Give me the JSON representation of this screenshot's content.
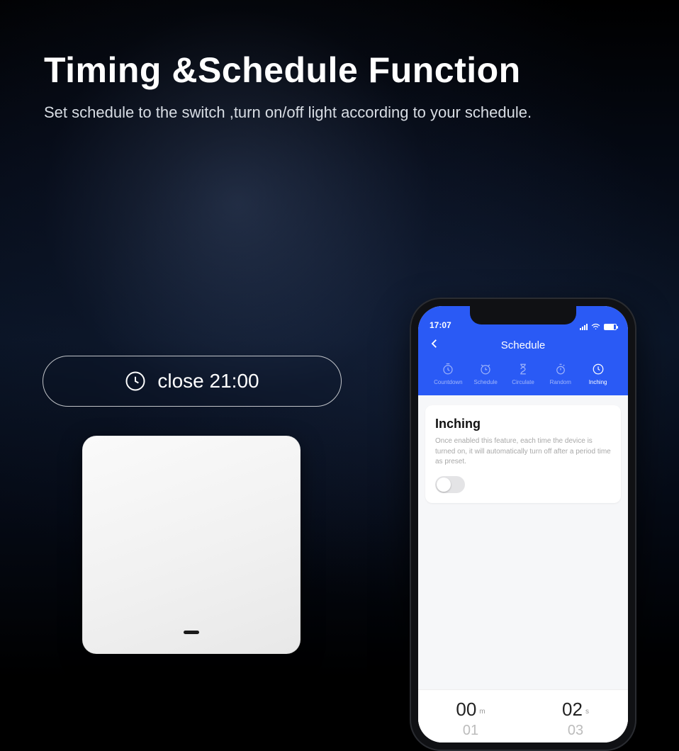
{
  "headline": {
    "title": "Timing &Schedule Function",
    "subtitle": "Set schedule to the switch ,turn on/off light according to your schedule."
  },
  "pill": {
    "text": "close 21:00"
  },
  "phone": {
    "status_time": "17:07",
    "header_title": "Schedule",
    "tabs": [
      {
        "label": "Countdown"
      },
      {
        "label": "Schedule"
      },
      {
        "label": "Circulate"
      },
      {
        "label": "Random"
      },
      {
        "label": "Inching"
      }
    ],
    "card": {
      "title": "Inching",
      "desc": "Once enabled this feature,  each time the device is turned on, it will automatically turn off after a period time as preset."
    },
    "picker": {
      "minutes": {
        "unit": "m",
        "main": "00",
        "next": "01"
      },
      "seconds": {
        "unit": "s",
        "main": "02",
        "next": "03"
      }
    }
  }
}
